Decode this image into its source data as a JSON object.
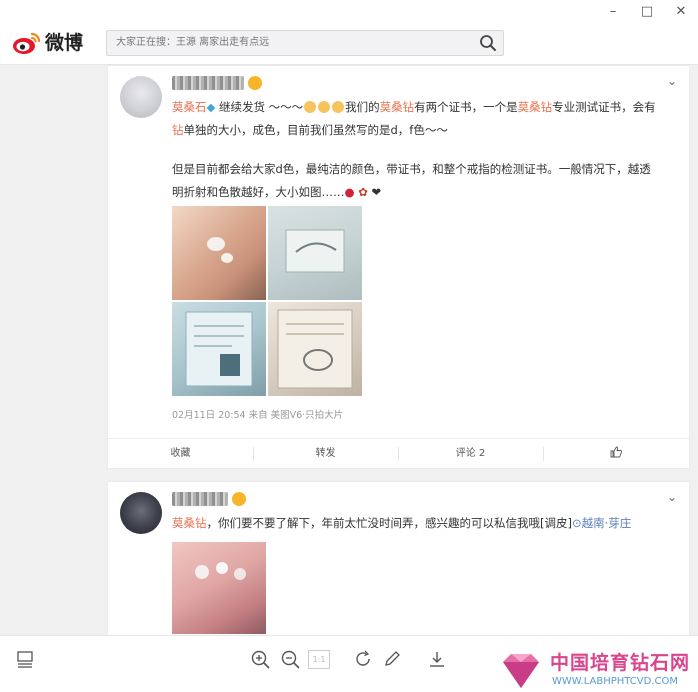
{
  "window": {
    "minimize": "–",
    "maximize": "□",
    "close": "✕"
  },
  "header": {
    "logo_text": "微博",
    "search_placeholder": "大家正在搜：王源 离家出走有点远",
    "search_icon": "search-icon"
  },
  "posts": [
    {
      "mention1": "莫桑石",
      "text_a": " 继续发货 ～～～",
      "text_b": "我们的",
      "mention2": "莫桑钻",
      "text_c": "有两个证书，一个是",
      "mention3": "莫桑钻",
      "text_d": "专业测试证书，会有",
      "mention4": "钻",
      "text_e": "单独的大小，成色，目前我们虽然写的是d，f色～～",
      "paragraph2": "但是目前都会给大家d色，最纯洁的颜色，带证书，和整个戒指的检测证书。一般情况下，越透明折射和色散越好，大小如图……",
      "meta": "02月11日 20:54 来自 美图V6·只拍大片",
      "actions": {
        "favorite": "收藏",
        "repost": "转发",
        "comment": "评论 2",
        "like_icon": "thumbs-up-icon"
      }
    },
    {
      "mention1": "莫桑钻",
      "text_a": "，你们要不要了解下，年前太忙没时间弄，感兴趣的可以私信我哦[调皮]",
      "location": "越南·芽庄"
    }
  ],
  "toolbar": {
    "page_indicator": "1:1"
  },
  "watermark": {
    "title": "中国培育钻石网",
    "url": "WWW.LABHPHTCVD.COM"
  }
}
